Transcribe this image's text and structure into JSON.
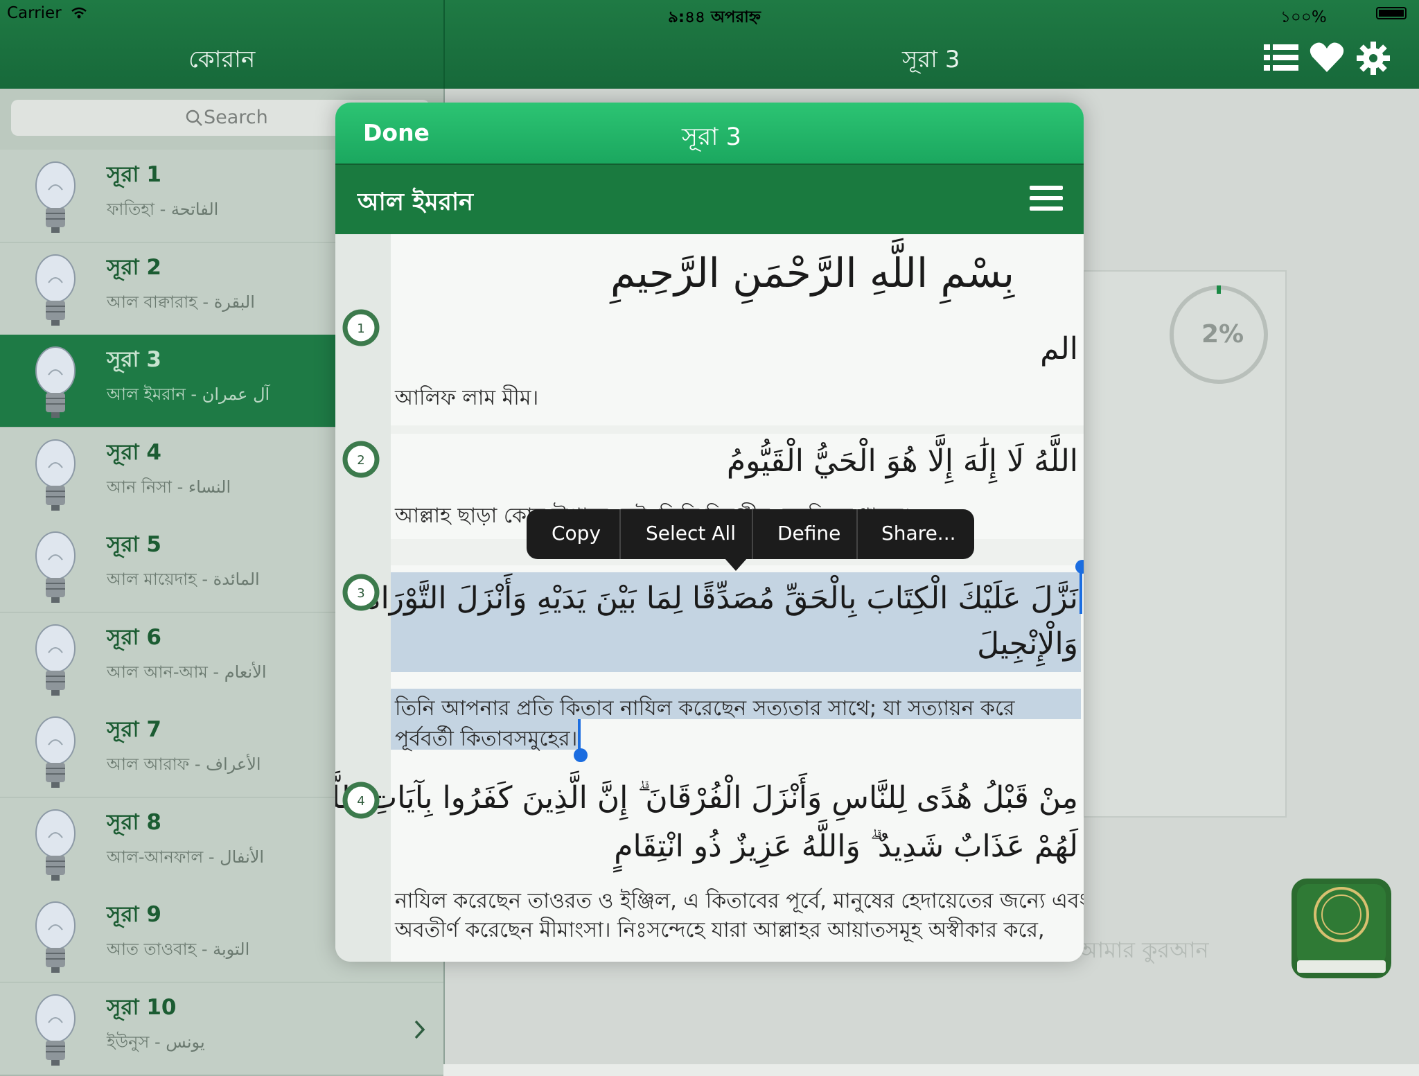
{
  "status": {
    "carrier": "Carrier",
    "time": "৯:৪৪ অপরাহ্ন",
    "battery": "১০০%"
  },
  "left_nav": {
    "title": "কোরান"
  },
  "right_nav": {
    "title": "সূরা 3"
  },
  "search": {
    "placeholder": "Search"
  },
  "surahs": [
    {
      "title": "সূরা 1",
      "subtitle": "ফাতিহা - الفاتحة"
    },
    {
      "title": "সূরা 2",
      "subtitle": "আল বাক্বারাহ - البقرة"
    },
    {
      "title": "সূরা 3",
      "subtitle": "আল ইমরান - آل عمران"
    },
    {
      "title": "সূরা 4",
      "subtitle": "আন নিসা - النساء"
    },
    {
      "title": "সূরা 5",
      "subtitle": "আল মায়েদাহ - المائدة"
    },
    {
      "title": "সূরা 6",
      "subtitle": "আল আন-আম - الأنعام"
    },
    {
      "title": "সূরা 7",
      "subtitle": "আল আরাফ - الأعراف"
    },
    {
      "title": "সূরা 8",
      "subtitle": "আল-আনফাল - الأنفال"
    },
    {
      "title": "সূরা 9",
      "subtitle": "আত তাওবাহ - التوبة"
    },
    {
      "title": "সূরা 10",
      "subtitle": "ইউনুস - يونس"
    }
  ],
  "background": {
    "progress_label": "2%",
    "faded_text": "আমার কুরআন"
  },
  "modal": {
    "done": "Done",
    "title": "সূরা 3",
    "subtitle": "আল ইমরান",
    "bismillah": "بِسْمِ اللَّهِ الرَّحْمَنِ الرَّحِيمِ",
    "ayahs": [
      {
        "num": "1",
        "arabic": "الم",
        "bengali": "আলিফ লাম মীম।"
      },
      {
        "num": "2",
        "arabic": "اللَّهُ لَا إِلَٰهَ إِلَّا هُوَ الْحَيُّ الْقَيُّومُ",
        "bengali": "আল্লাহ ছাড়া কোন উপাস্য নেই, তিনি চিরঞ্জীব, সবকিছুর ধারক।"
      },
      {
        "num": "3",
        "arabic_1": "نَزَّلَ عَلَيْكَ الْكِتَابَ بِالْحَقِّ مُصَدِّقًا لِمَا بَيْنَ يَدَيْهِ وَأَنْزَلَ التَّوْرَاةَ",
        "arabic_2": "وَالْإِنْجِيلَ",
        "bengali_1": "তিনি আপনার প্রতি কিতাব নাযিল করেছেন সত্যতার সাথে; যা সত্যায়ন করে",
        "bengali_2": "পূর্ববর্তী কিতাবসমুহের।"
      },
      {
        "num": "4",
        "arabic_1": "مِنْ قَبْلُ هُدًى لِلنَّاسِ وَأَنْزَلَ الْفُرْقَانَ ۗ إِنَّ الَّذِينَ كَفَرُوا بِآيَاتِ اللَّهِ",
        "arabic_2": "لَهُمْ عَذَابٌ شَدِيدٌ ۗ وَاللَّهُ عَزِيزٌ ذُو انْتِقَامٍ",
        "bengali_1": "নাযিল করেছেন তাওরত ও ইঞ্জিল, এ কিতাবের পূর্বে, মানুষের হেদায়েতের জন্যে এবং",
        "bengali_2": "অবতীর্ণ করেছেন মীমাংসা। নিঃসন্দেহে যারা আল্লাহর আয়াতসমূহ অস্বীকার করে,"
      }
    ]
  },
  "context_menu": {
    "copy": "Copy",
    "select_all": "Select All",
    "define": "Define",
    "share": "Share..."
  },
  "colors": {
    "nav_green": "#1f7a44",
    "modal_green": "#2cc473",
    "selection": "#c4d4e2",
    "handle_blue": "#1b6de0"
  }
}
